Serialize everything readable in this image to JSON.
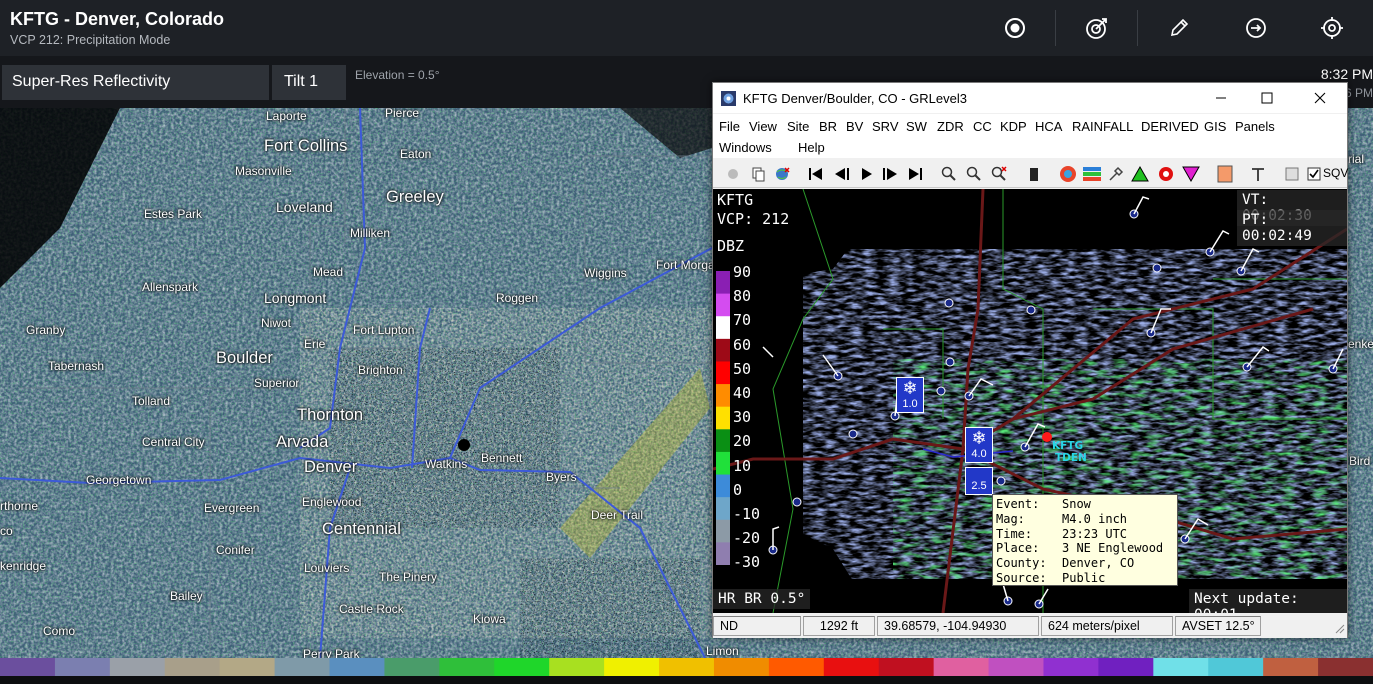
{
  "header": {
    "title": "KFTG - Denver, Colorado",
    "subtitle": "VCP 212: Precipitation Mode",
    "icons": [
      "record-icon",
      "target-check-icon",
      "pencil-icon",
      "login-arrow-icon",
      "crosshair-icon"
    ]
  },
  "product": {
    "product_name": "Super-Res Reflectivity",
    "tilt": "Tilt 1",
    "elevation": "Elevation = 0.5°",
    "time": "8:32 PM",
    "time_partial": "6 PM"
  },
  "map": {
    "cities": [
      {
        "name": "Laporte",
        "size": "s"
      },
      {
        "name": "Pierce",
        "size": "s"
      },
      {
        "name": "Fort Collins",
        "size": "l"
      },
      {
        "name": "Eaton",
        "size": "s"
      },
      {
        "name": "Masonville",
        "size": "s"
      },
      {
        "name": "Greeley",
        "size": "l"
      },
      {
        "name": "Loveland",
        "size": "m"
      },
      {
        "name": "Estes Park",
        "size": "s"
      },
      {
        "name": "Milliken",
        "size": "s"
      },
      {
        "name": "Wiggins",
        "size": "s"
      },
      {
        "name": "Fort Morgan",
        "size": "s"
      },
      {
        "name": "Mead",
        "size": "s"
      },
      {
        "name": "Allenspark",
        "size": "s"
      },
      {
        "name": "Longmont",
        "size": "m"
      },
      {
        "name": "Roggen",
        "size": "s"
      },
      {
        "name": "Niwot",
        "size": "s"
      },
      {
        "name": "Fort Lupton",
        "size": "s"
      },
      {
        "name": "Granby",
        "size": "s"
      },
      {
        "name": "Erie",
        "size": "s"
      },
      {
        "name": "Boulder",
        "size": "l"
      },
      {
        "name": "Tabernash",
        "size": "s"
      },
      {
        "name": "Brighton",
        "size": "s"
      },
      {
        "name": "Superior",
        "size": "s"
      },
      {
        "name": "Tolland",
        "size": "s"
      },
      {
        "name": "Thornton",
        "size": "l"
      },
      {
        "name": "Central City",
        "size": "s"
      },
      {
        "name": "Arvada",
        "size": "l"
      },
      {
        "name": "Bennett",
        "size": "s"
      },
      {
        "name": "Watkins",
        "size": "s"
      },
      {
        "name": "Denver",
        "size": "l"
      },
      {
        "name": "Byers",
        "size": "s"
      },
      {
        "name": "Georgetown",
        "size": "s"
      },
      {
        "name": "Englewood",
        "size": "s"
      },
      {
        "name": "Evergreen",
        "size": "s"
      },
      {
        "name": "Deer Trail",
        "size": "s"
      },
      {
        "name": "rthorne",
        "size": "s"
      },
      {
        "name": "Centennial",
        "size": "l"
      },
      {
        "name": "co",
        "size": "s"
      },
      {
        "name": "Conifer",
        "size": "s"
      },
      {
        "name": "Louviers",
        "size": "s"
      },
      {
        "name": "kenridge",
        "size": "s"
      },
      {
        "name": "The Pinery",
        "size": "s"
      },
      {
        "name": "Bailey",
        "size": "s"
      },
      {
        "name": "Castle Rock",
        "size": "s"
      },
      {
        "name": "Kiowa",
        "size": "s"
      },
      {
        "name": "Como",
        "size": "s"
      },
      {
        "name": "Perry Park",
        "size": "s"
      },
      {
        "name": "Limon",
        "size": "s"
      },
      {
        "name": "rial",
        "size": "s"
      },
      {
        "name": "enke",
        "size": "s"
      },
      {
        "name": "Bird",
        "size": "s"
      }
    ]
  },
  "grlevel3": {
    "window_title": "KFTG Denver/Boulder, CO - GRLevel3",
    "menus": [
      "File",
      "View",
      "Site",
      "BR",
      "BV",
      "SRV",
      "SW",
      "ZDR",
      "CC",
      "KDP",
      "HCA",
      "RAINFALL",
      "DERIVED",
      "GIS",
      "Panels",
      "Windows",
      "Help"
    ],
    "sqv_label": "SQV",
    "overlay": {
      "site": "KFTG",
      "vcp": "VCP: 212",
      "vt": "VT: 00:02:30",
      "pt": "PT: 00:02:49",
      "unit": "DBZ",
      "product_tilt": "HR BR 0.5°",
      "next_update": "Next update: 00:01",
      "radar_label_1": "KFTG",
      "radar_label_2": "TDEN"
    },
    "legend": [
      "90",
      "80",
      "70",
      "60",
      "50",
      "40",
      "30",
      "20",
      "10",
      "0",
      "-10",
      "-20",
      "-30"
    ],
    "legend_colors": [
      "#8a1fb3",
      "#d44cf0",
      "#ffffff",
      "#9d0a17",
      "#ff0000",
      "#ff8c00",
      "#ffe000",
      "#0a8f14",
      "#20e03a",
      "#3d8bd9",
      "#6ea6c9",
      "#8c9aa6",
      "#8f7eaf"
    ],
    "reports": [
      {
        "mag": "1.0"
      },
      {
        "mag": "4.0"
      },
      {
        "mag": "2.5"
      }
    ],
    "tooltip": {
      "event_label": "Event:",
      "event": "Snow",
      "mag_label": "Mag:",
      "mag": "M4.0 inch",
      "time_label": "Time:",
      "time": "23:23 UTC",
      "place_label": "Place:",
      "place": "3 NE Englewood",
      "county_label": "County:",
      "county": "Denver, CO",
      "source_label": "Source:",
      "source": "Public"
    },
    "status": {
      "mode": "ND",
      "height": "1292 ft",
      "coords": "39.68579, -104.94930",
      "resolution": "624 meters/pixel",
      "avset": "AVSET 12.5°"
    }
  },
  "colorbar": [
    "#6b4f9e",
    "#7b7fb0",
    "#9aa0a8",
    "#a89f8a",
    "#b3a886",
    "#7f9aa8",
    "#5a8fbf",
    "#4a9c6a",
    "#2fbf3a",
    "#1fd62a",
    "#a8e020",
    "#f0f000",
    "#f0c000",
    "#f08c00",
    "#ff5a00",
    "#e81010",
    "#c01020",
    "#e060a0",
    "#c050c0",
    "#9030d0",
    "#7020c0",
    "#70e0e8",
    "#50c8d8",
    "#c06040",
    "#8a3030"
  ]
}
